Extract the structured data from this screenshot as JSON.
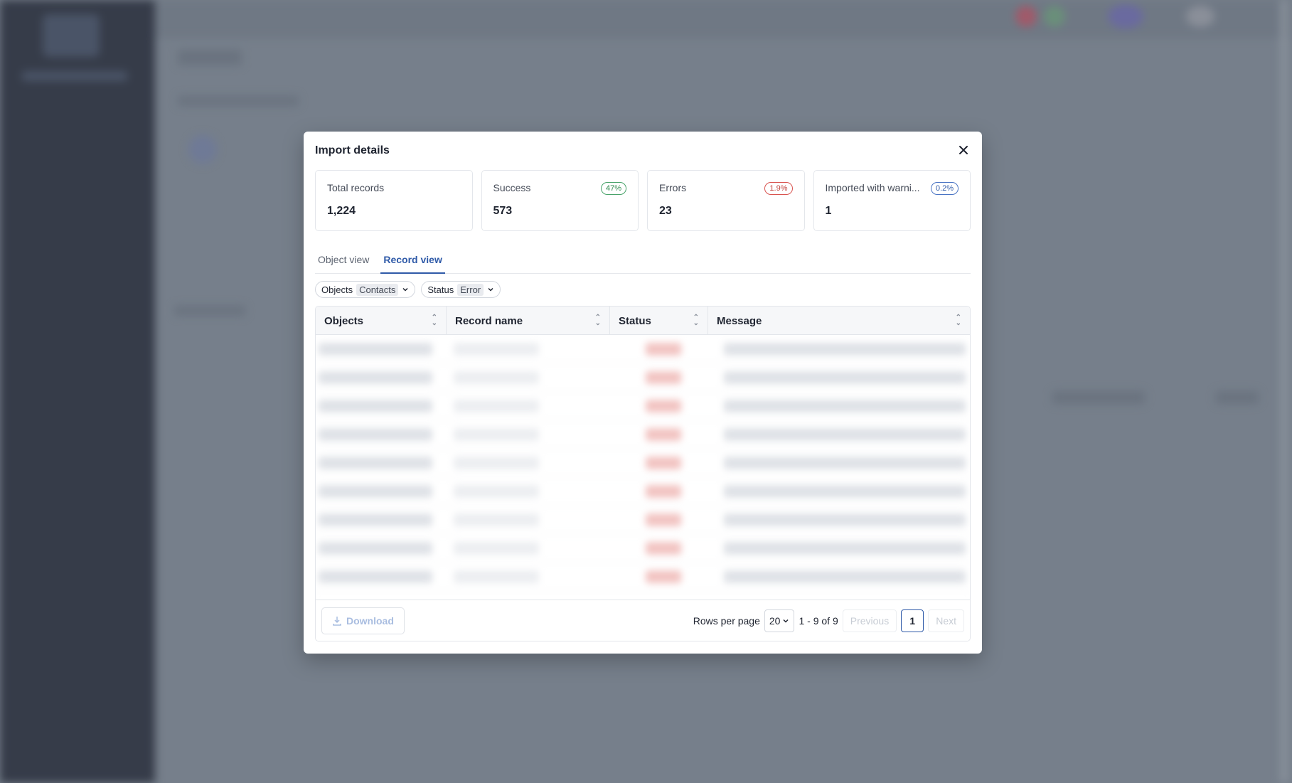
{
  "dialog": {
    "title": "Import details",
    "close_icon": "close-icon"
  },
  "stats": [
    {
      "label": "Total records",
      "value": "1,224",
      "badge": ""
    },
    {
      "label": "Success",
      "value": "573",
      "badge": "47%",
      "badge_color": "#49a36a"
    },
    {
      "label": "Errors",
      "value": "23",
      "badge": "1.9%",
      "badge_color": "#d9534f"
    },
    {
      "label": "Imported with warni...",
      "value": "1",
      "badge": "0.2%",
      "badge_color": "#4a74c4"
    }
  ],
  "tabs": [
    {
      "label": "Object view",
      "active": false
    },
    {
      "label": "Record view",
      "active": true
    }
  ],
  "filters": [
    {
      "label": "Objects",
      "value": "Contacts"
    },
    {
      "label": "Status",
      "value": "Error"
    }
  ],
  "table": {
    "columns": [
      "Objects",
      "Record name",
      "Status",
      "Message"
    ]
  },
  "footer": {
    "download_label": "Download",
    "rows_per_page_label": "Rows per page",
    "rows_per_page_value": "20",
    "range_text": "1 - 9 of 9",
    "previous_label": "Previous",
    "current_page": "1",
    "next_label": "Next"
  },
  "colors": {
    "accent": "#2f5aa8",
    "overlay": "#767f8b"
  }
}
